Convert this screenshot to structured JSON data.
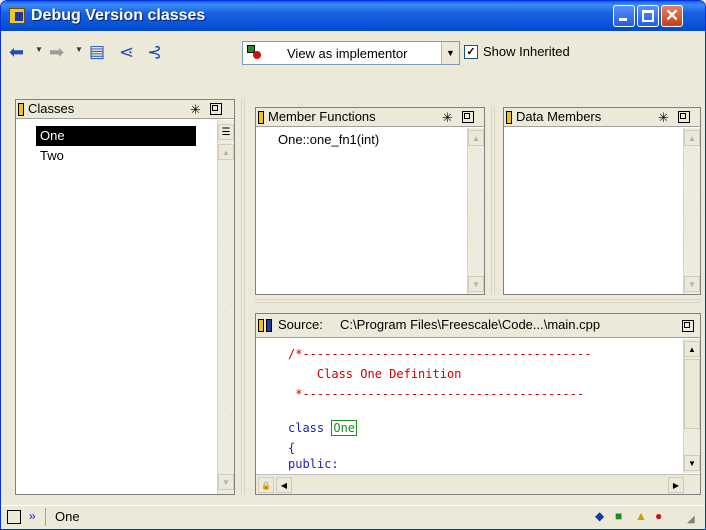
{
  "window": {
    "title": "Debug Version classes"
  },
  "toolbar": {
    "back_icon": "back-arrow-icon",
    "forward_icon": "forward-arrow-icon",
    "view_select": "View as implementor",
    "show_inherited": "Show Inherited",
    "show_inherited_checked": true
  },
  "classes_pane": {
    "title": "Classes",
    "items": [
      "One",
      "Two"
    ],
    "selected": "One"
  },
  "member_functions_pane": {
    "title": "Member Functions",
    "items": [
      "One::one_fn1(int)"
    ]
  },
  "data_members_pane": {
    "title": "Data Members",
    "items": []
  },
  "source_pane": {
    "label": "Source:",
    "path": "C:\\Program Files\\Freescale\\Code...\\main.cpp",
    "lines": [
      "/*----------------------------------------",
      "    Class One Definition",
      " *---------------------------------------",
      "",
      "class One",
      "{",
      "public:"
    ],
    "highlighted_word": "One"
  },
  "statusbar": {
    "text": "One"
  },
  "colors": {
    "comment": "#cc0000",
    "keyword": "#1d1dbf",
    "highlight": "#1a8f1a",
    "titlebar": "#0a5fe8"
  }
}
